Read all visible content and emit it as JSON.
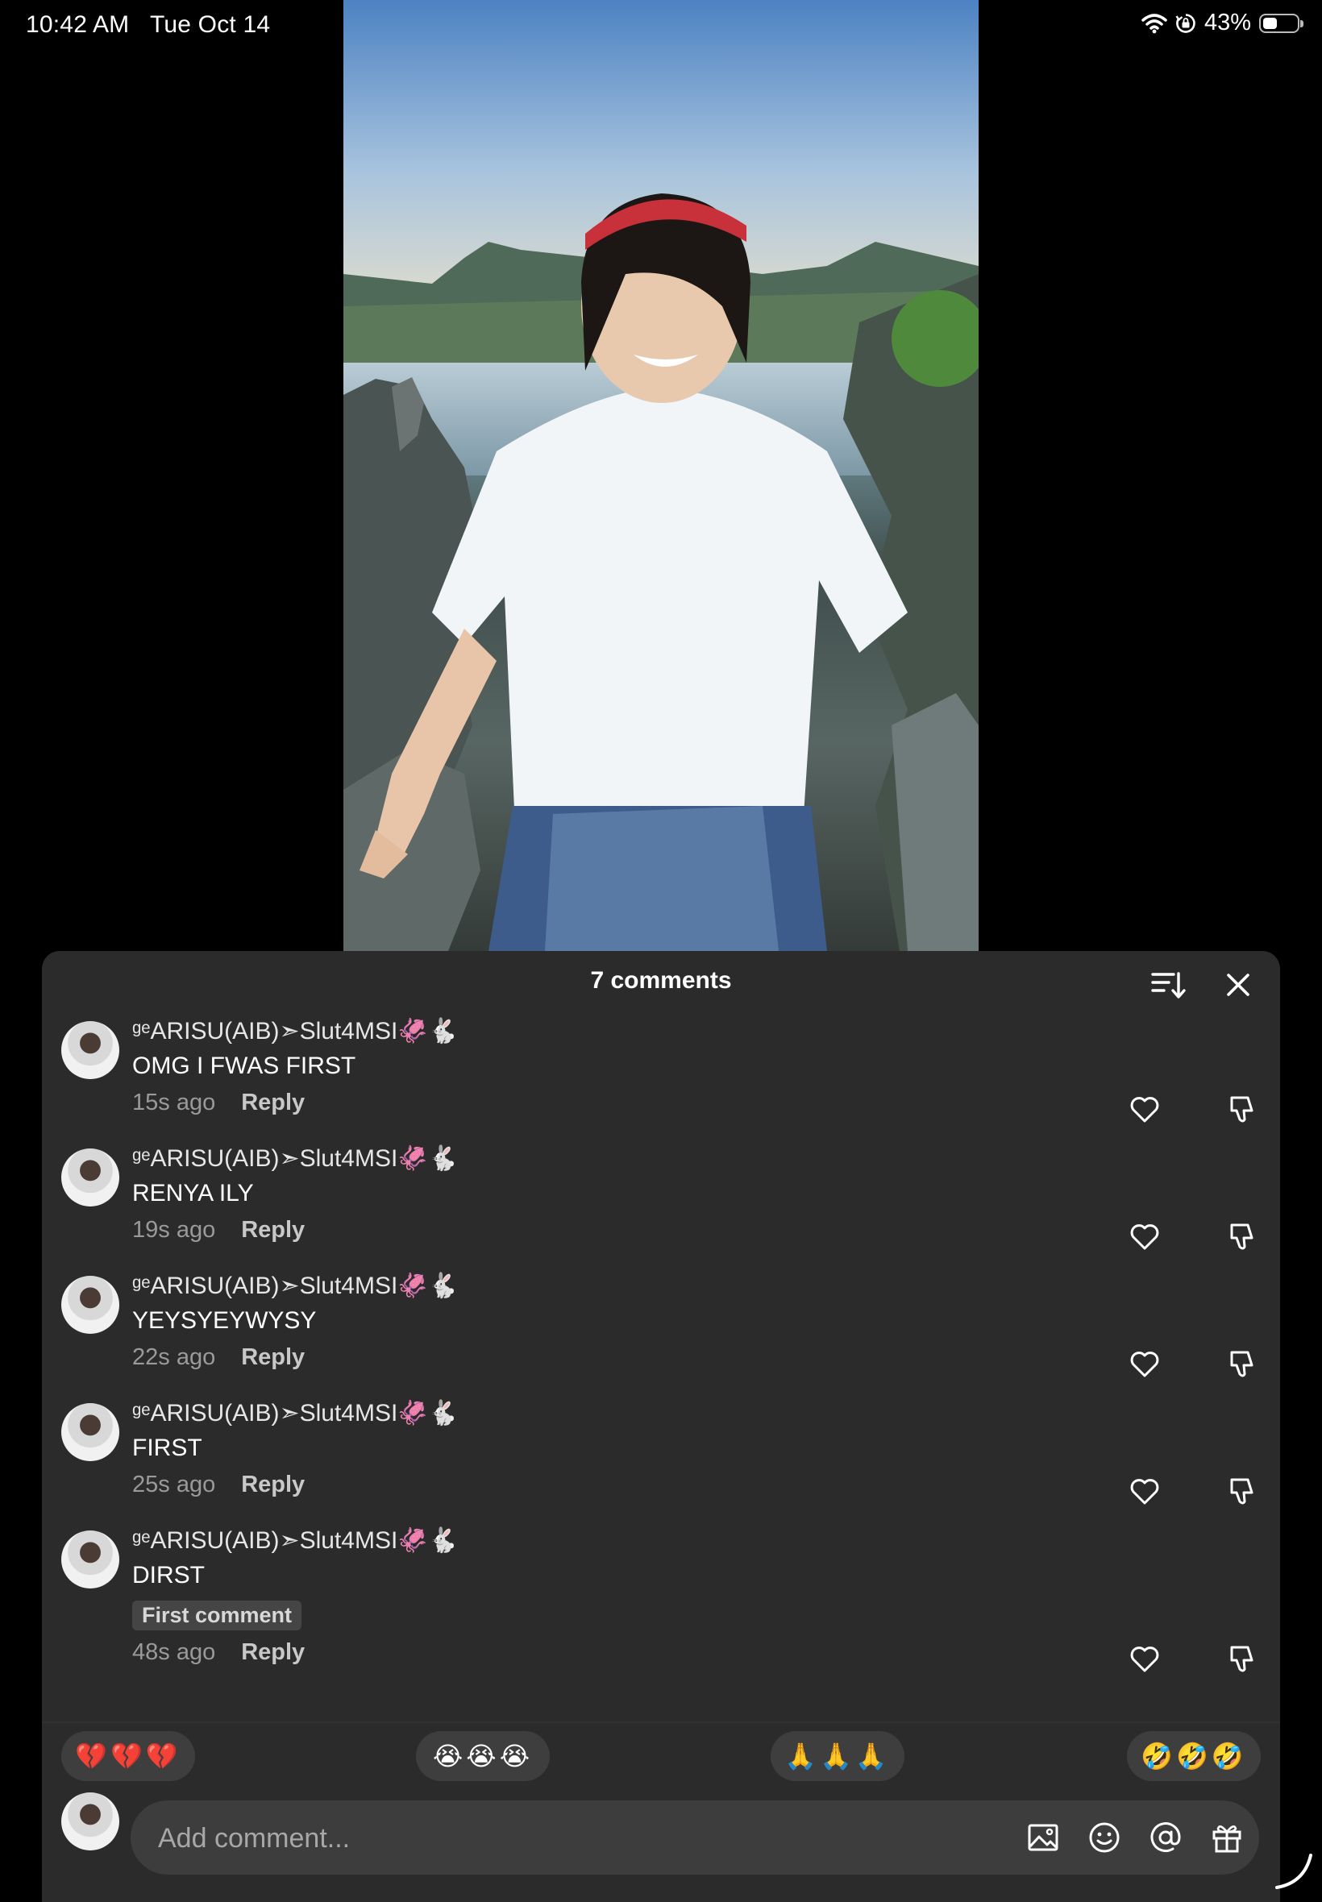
{
  "status_bar": {
    "time": "10:42 AM",
    "date": "Tue Oct 14",
    "battery_text": "43%",
    "battery_level": 0.43,
    "icons": [
      "wifi-icon",
      "orientation-lock-icon",
      "battery-icon"
    ]
  },
  "video": {
    "description_icons": [
      "video-frame"
    ]
  },
  "comments_panel": {
    "title": "7 comments",
    "icons": [
      "sort-icon",
      "close-icon"
    ],
    "comments": [
      {
        "username": "ᵍᵉARISU(AIB)➣Slut4MSI🦑🐇",
        "text": "OMG I FWAS FIRST",
        "time": "15s ago",
        "reply_label": "Reply",
        "badge": ""
      },
      {
        "username": "ᵍᵉARISU(AIB)➣Slut4MSI🦑🐇",
        "text": "RENYA ILY",
        "time": "19s ago",
        "reply_label": "Reply",
        "badge": ""
      },
      {
        "username": "ᵍᵉARISU(AIB)➣Slut4MSI🦑🐇",
        "text": "YEYSYEYWYSY",
        "time": "22s ago",
        "reply_label": "Reply",
        "badge": ""
      },
      {
        "username": "ᵍᵉARISU(AIB)➣Slut4MSI🦑🐇",
        "text": "FIRST",
        "time": "25s ago",
        "reply_label": "Reply",
        "badge": ""
      },
      {
        "username": "ᵍᵉARISU(AIB)➣Slut4MSI🦑🐇",
        "text": "DIRST",
        "time": "48s ago",
        "reply_label": "Reply",
        "badge": "First comment"
      }
    ],
    "reactions": [
      "💔💔💔",
      "😭😭😭",
      "🙏🙏🙏",
      "🤣🤣🤣"
    ],
    "input": {
      "placeholder": "Add comment...",
      "icons": [
        "image-icon",
        "emoji-icon",
        "mention-icon",
        "gift-icon"
      ]
    }
  },
  "colors": {
    "panel_bg": "#2b2b2b",
    "input_bg": "#3d3d3d",
    "muted_text": "#9a9a9a"
  }
}
